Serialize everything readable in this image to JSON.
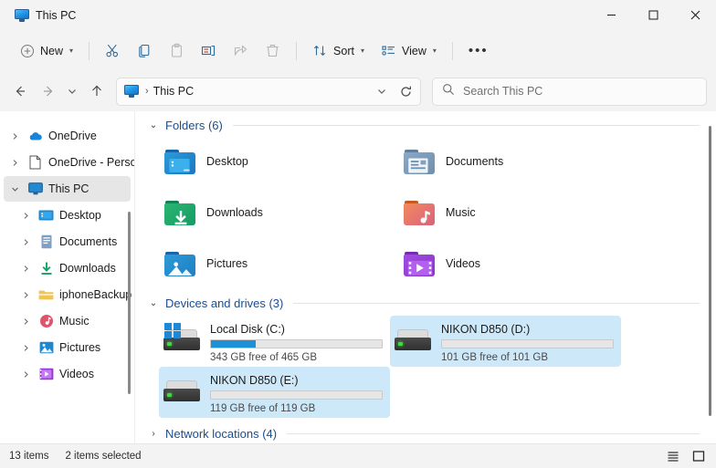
{
  "window": {
    "tab_title": "This PC",
    "tab_icon": "monitor-icon",
    "minimize_label": "Minimize",
    "maximize_label": "Maximize",
    "close_label": "Close"
  },
  "command_bar": {
    "new_label": "New",
    "new_icon": "plus-circle-icon",
    "cut_icon": "scissors-icon",
    "copy_icon": "copy-icon",
    "paste_icon": "clipboard-icon",
    "rename_icon": "rename-icon",
    "share_icon": "share-icon",
    "delete_icon": "trash-icon",
    "sort_label": "Sort",
    "sort_icon": "sort-arrows-icon",
    "view_label": "View",
    "view_icon": "view-list-icon",
    "more_label": "•••"
  },
  "nav": {
    "back_icon": "arrow-left-icon",
    "forward_icon": "arrow-right-icon",
    "recent_icon": "chevron-down-icon",
    "up_icon": "arrow-up-icon"
  },
  "address": {
    "icon": "monitor-icon",
    "separator": "›",
    "path": "This PC",
    "dropdown_icon": "chevron-down-icon",
    "refresh_icon": "refresh-icon"
  },
  "search": {
    "icon": "search-icon",
    "placeholder": "Search This PC",
    "value": ""
  },
  "sidebar": {
    "items": [
      {
        "label": "OneDrive",
        "icon": "cloud-icon",
        "level": 1,
        "expander": "›",
        "selected": false
      },
      {
        "label": "OneDrive - Perso",
        "icon": "document-icon",
        "level": 1,
        "expander": "›",
        "selected": false
      },
      {
        "label": "This PC",
        "icon": "monitor-icon",
        "level": 1,
        "expander": "⌄",
        "selected": true
      },
      {
        "label": "Desktop",
        "icon": "desktop-folder-icon",
        "level": 2,
        "expander": "›",
        "selected": false
      },
      {
        "label": "Documents",
        "icon": "documents-folder-icon",
        "level": 2,
        "expander": "›",
        "selected": false
      },
      {
        "label": "Downloads",
        "icon": "downloads-icon",
        "level": 2,
        "expander": "›",
        "selected": false
      },
      {
        "label": "iphoneBackup",
        "icon": "folder-icon",
        "level": 2,
        "expander": "›",
        "selected": false
      },
      {
        "label": "Music",
        "icon": "music-icon",
        "level": 2,
        "expander": "›",
        "selected": false
      },
      {
        "label": "Pictures",
        "icon": "pictures-icon",
        "level": 2,
        "expander": "›",
        "selected": false
      },
      {
        "label": "Videos",
        "icon": "videos-icon",
        "level": 2,
        "expander": "›",
        "selected": false
      }
    ]
  },
  "content": {
    "folders_group": {
      "title": "Folders (6)",
      "expander": "⌄",
      "items": [
        {
          "label": "Desktop",
          "icon": "desktop-folder-icon",
          "c1": "#2d9bd8",
          "c2": "#1976c6",
          "tab": "#1565b0"
        },
        {
          "label": "Documents",
          "icon": "documents-folder-icon",
          "c1": "#8ba8c4",
          "c2": "#6f8fae",
          "tab": "#5d7e9c"
        },
        {
          "label": "Downloads",
          "icon": "downloads-folder-icon",
          "c1": "#2bb673",
          "c2": "#159b63",
          "tab": "#0f8553"
        },
        {
          "label": "Music",
          "icon": "music-folder-icon",
          "c1": "#f28a5c",
          "c2": "#d9627e",
          "tab": "#c9591f"
        },
        {
          "label": "Pictures",
          "icon": "pictures-folder-icon",
          "c1": "#2d9bd8",
          "c2": "#1f7ec2",
          "tab": "#1565b0"
        },
        {
          "label": "Videos",
          "icon": "videos-folder-icon",
          "c1": "#a04ee0",
          "c2": "#8a32cc",
          "tab": "#7a27b8"
        }
      ]
    },
    "drives_group": {
      "title": "Devices and drives (3)",
      "expander": "⌄",
      "items": [
        {
          "name": "Local Disk (C:)",
          "free_text": "343 GB free of 465 GB",
          "used_percent": 26,
          "selected": false,
          "windows_badge": true
        },
        {
          "name": "NIKON D850 (D:)",
          "free_text": "101 GB free of 101 GB",
          "used_percent": 0,
          "selected": true,
          "windows_badge": false
        },
        {
          "name": "NIKON D850  (E:)",
          "free_text": "119 GB free of 119 GB",
          "used_percent": 0,
          "selected": true,
          "windows_badge": false
        }
      ]
    },
    "network_group": {
      "title": "Network locations (4)",
      "expander": "›"
    }
  },
  "status_bar": {
    "item_count": "13 items",
    "selection": "2 items selected",
    "details_view_icon": "list-view-icon",
    "large_icons_view_icon": "tiles-view-icon"
  },
  "colors": {
    "accent": "#1e90d6",
    "selection": "#cde8f9",
    "group_title": "#1b4d8f",
    "chrome": "#f3f3f3"
  }
}
